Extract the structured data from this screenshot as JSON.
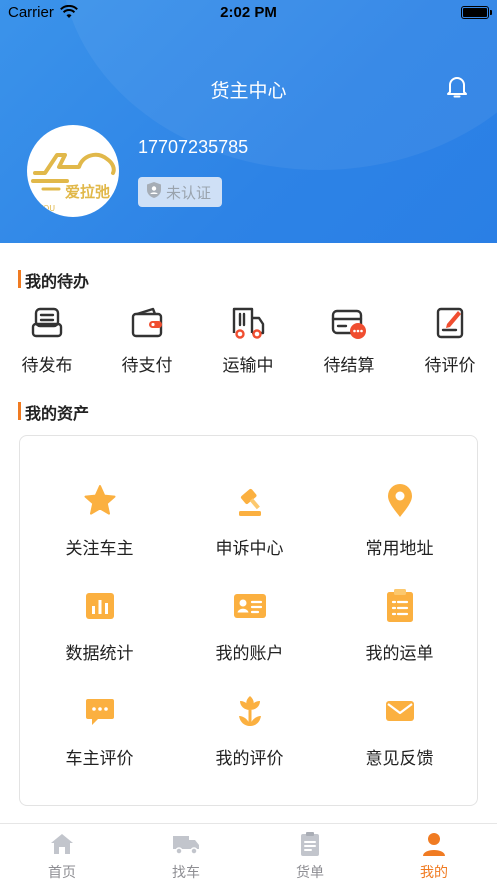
{
  "status_bar": {
    "carrier": "Carrier",
    "time": "2:02 PM"
  },
  "header": {
    "title": "货主中心"
  },
  "profile": {
    "phone": "17707235785",
    "verify_status": "未认证",
    "logo_text": "爱拉弛",
    "logo_sub": "LAYOU"
  },
  "todo": {
    "title": "我的待办",
    "items": [
      {
        "label": "待发布",
        "icon": "publish-icon"
      },
      {
        "label": "待支付",
        "icon": "wallet-icon"
      },
      {
        "label": "运输中",
        "icon": "truck-icon"
      },
      {
        "label": "待结算",
        "icon": "settle-card-icon"
      },
      {
        "label": "待评价",
        "icon": "edit-note-icon"
      }
    ]
  },
  "assets": {
    "title": "我的资产",
    "items": [
      {
        "label": "关注车主",
        "icon": "star-icon"
      },
      {
        "label": "申诉中心",
        "icon": "gavel-icon"
      },
      {
        "label": "常用地址",
        "icon": "location-pin-icon"
      },
      {
        "label": "数据统计",
        "icon": "bar-chart-icon"
      },
      {
        "label": "我的账户",
        "icon": "id-card-icon"
      },
      {
        "label": "我的运单",
        "icon": "clipboard-icon"
      },
      {
        "label": "车主评价",
        "icon": "chat-bubble-icon"
      },
      {
        "label": "我的评价",
        "icon": "flower-icon"
      },
      {
        "label": "意见反馈",
        "icon": "mail-icon"
      }
    ]
  },
  "tabbar": {
    "items": [
      {
        "label": "首页",
        "icon": "home-icon",
        "active": false
      },
      {
        "label": "找车",
        "icon": "truck-icon",
        "active": false
      },
      {
        "label": "货单",
        "icon": "clipboard-icon",
        "active": false
      },
      {
        "label": "我的",
        "icon": "user-icon",
        "active": true
      }
    ]
  },
  "colors": {
    "primary_blue": "#2d83e6",
    "accent_orange": "#f07b22",
    "icon_orange": "#fbb040",
    "icon_dark": "#333333",
    "icon_red": "#f04e30",
    "tab_inactive": "#8e8e93"
  }
}
